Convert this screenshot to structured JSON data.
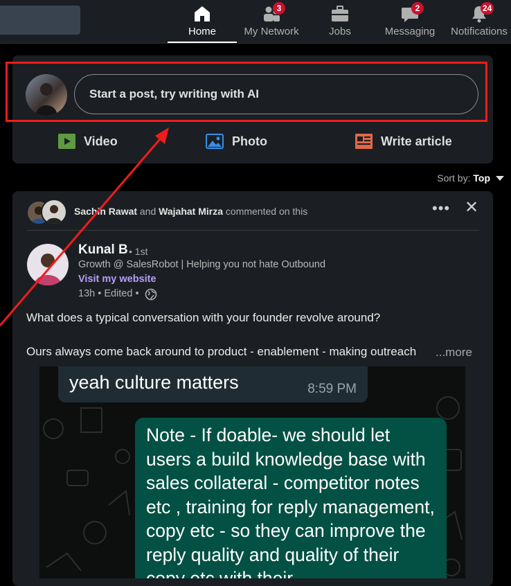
{
  "nav": {
    "items": [
      {
        "label": "Home",
        "icon": "home-icon",
        "badge": ""
      },
      {
        "label": "My Network",
        "icon": "network-icon",
        "badge": "3"
      },
      {
        "label": "Jobs",
        "icon": "briefcase-icon",
        "badge": ""
      },
      {
        "label": "Messaging",
        "icon": "chat-icon",
        "badge": "2"
      },
      {
        "label": "Notifications",
        "icon": "bell-icon",
        "badge": "24"
      }
    ],
    "active": "Home"
  },
  "composer": {
    "placeholder": "Start a post, try writing with AI",
    "actions": [
      {
        "label": "Video",
        "icon": "video-icon",
        "color": "#5f9b41"
      },
      {
        "label": "Photo",
        "icon": "photo-icon",
        "color": "#378fe9"
      },
      {
        "label": "Write article",
        "icon": "article-icon",
        "color": "#e06847"
      }
    ]
  },
  "feed": {
    "sort_label": "Sort by:",
    "sort_value": "Top"
  },
  "post": {
    "social_context": {
      "user1": "Sachin Rawat",
      "joiner": "and",
      "user2": "Wajahat Mirza",
      "action": "commented on this"
    },
    "author": {
      "name": "Kunal B",
      "degree": "• 1st",
      "headline": "Growth @ SalesRobot | Helping you not hate Outbound",
      "link": "Visit my website",
      "time": "13h • Edited •"
    },
    "text_line1": "What does a typical conversation with your founder revolve around?",
    "text_line2": "Ours always come back around to product - enablement - making outreach",
    "see_more": "...more",
    "image": {
      "bubble1_text": "yeah culture matters",
      "bubble1_time": "8:59 PM",
      "bubble2_text": "Note - If doable- we should let users a build knowledge base with sales collateral - competitor notes etc , training for reply management, copy etc - so they can improve the reply quality and quality of their copy etc with their"
    }
  },
  "colors": {
    "highlight_box": "#f21b1b",
    "link": "#b69df8",
    "badge": "#cb112d"
  }
}
